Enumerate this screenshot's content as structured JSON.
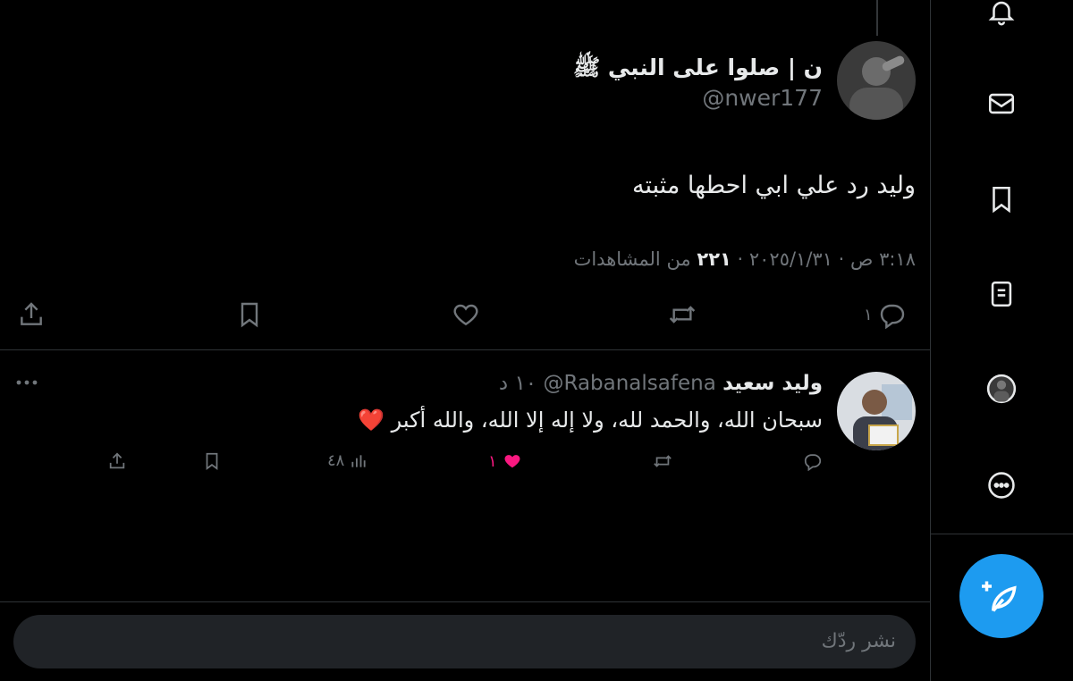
{
  "tweet": {
    "display_name": "ن | صلوا على النبي ﷺ",
    "handle": "@nwer177",
    "text": "وليد رد علي ابي احطها مثبته",
    "timestamp": "٣:١٨ ص · ٢٠٢٥/١/٣١ ·",
    "views_count": "٢٢١",
    "views_label": "من المشاهدات",
    "reply_count": "١"
  },
  "reply": {
    "display_name": "وليد سعيد",
    "handle": "@Rabanalsafena",
    "time": "١٠ د",
    "text": "سبحان الله، والحمد لله، ولا إله إلا الله، والله أكبر ❤️",
    "like_count": "١",
    "view_count": "٤٨"
  },
  "reply_input": {
    "placeholder": "نشر ردّك"
  },
  "colors": {
    "accent": "#1d9bf0",
    "like": "#f91880",
    "muted": "#71767b",
    "text": "#e7e9ea"
  },
  "icons": [
    "notifications-icon",
    "messages-icon",
    "bookmarks-icon",
    "lists-icon",
    "profile-avatar",
    "more-icon",
    "compose-icon"
  ]
}
